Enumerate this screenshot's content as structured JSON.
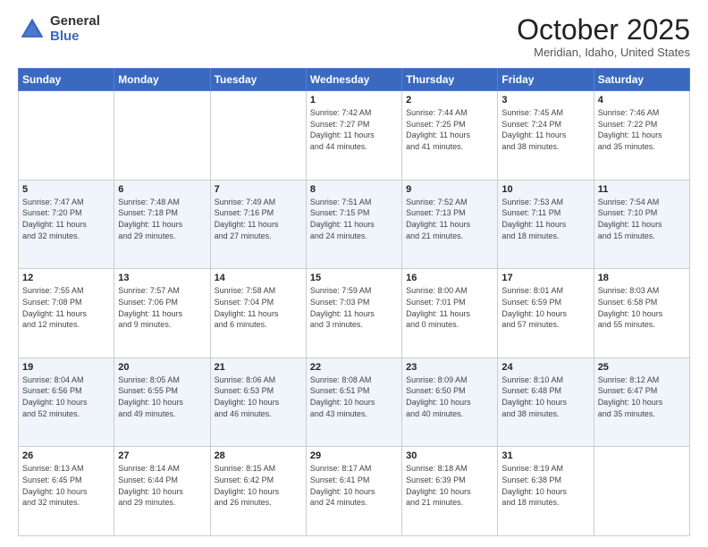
{
  "header": {
    "logo_general": "General",
    "logo_blue": "Blue",
    "title": "October 2025",
    "subtitle": "Meridian, Idaho, United States"
  },
  "weekdays": [
    "Sunday",
    "Monday",
    "Tuesday",
    "Wednesday",
    "Thursday",
    "Friday",
    "Saturday"
  ],
  "weeks": [
    [
      {
        "day": "",
        "info": ""
      },
      {
        "day": "",
        "info": ""
      },
      {
        "day": "",
        "info": ""
      },
      {
        "day": "1",
        "info": "Sunrise: 7:42 AM\nSunset: 7:27 PM\nDaylight: 11 hours\nand 44 minutes."
      },
      {
        "day": "2",
        "info": "Sunrise: 7:44 AM\nSunset: 7:25 PM\nDaylight: 11 hours\nand 41 minutes."
      },
      {
        "day": "3",
        "info": "Sunrise: 7:45 AM\nSunset: 7:24 PM\nDaylight: 11 hours\nand 38 minutes."
      },
      {
        "day": "4",
        "info": "Sunrise: 7:46 AM\nSunset: 7:22 PM\nDaylight: 11 hours\nand 35 minutes."
      }
    ],
    [
      {
        "day": "5",
        "info": "Sunrise: 7:47 AM\nSunset: 7:20 PM\nDaylight: 11 hours\nand 32 minutes."
      },
      {
        "day": "6",
        "info": "Sunrise: 7:48 AM\nSunset: 7:18 PM\nDaylight: 11 hours\nand 29 minutes."
      },
      {
        "day": "7",
        "info": "Sunrise: 7:49 AM\nSunset: 7:16 PM\nDaylight: 11 hours\nand 27 minutes."
      },
      {
        "day": "8",
        "info": "Sunrise: 7:51 AM\nSunset: 7:15 PM\nDaylight: 11 hours\nand 24 minutes."
      },
      {
        "day": "9",
        "info": "Sunrise: 7:52 AM\nSunset: 7:13 PM\nDaylight: 11 hours\nand 21 minutes."
      },
      {
        "day": "10",
        "info": "Sunrise: 7:53 AM\nSunset: 7:11 PM\nDaylight: 11 hours\nand 18 minutes."
      },
      {
        "day": "11",
        "info": "Sunrise: 7:54 AM\nSunset: 7:10 PM\nDaylight: 11 hours\nand 15 minutes."
      }
    ],
    [
      {
        "day": "12",
        "info": "Sunrise: 7:55 AM\nSunset: 7:08 PM\nDaylight: 11 hours\nand 12 minutes."
      },
      {
        "day": "13",
        "info": "Sunrise: 7:57 AM\nSunset: 7:06 PM\nDaylight: 11 hours\nand 9 minutes."
      },
      {
        "day": "14",
        "info": "Sunrise: 7:58 AM\nSunset: 7:04 PM\nDaylight: 11 hours\nand 6 minutes."
      },
      {
        "day": "15",
        "info": "Sunrise: 7:59 AM\nSunset: 7:03 PM\nDaylight: 11 hours\nand 3 minutes."
      },
      {
        "day": "16",
        "info": "Sunrise: 8:00 AM\nSunset: 7:01 PM\nDaylight: 11 hours\nand 0 minutes."
      },
      {
        "day": "17",
        "info": "Sunrise: 8:01 AM\nSunset: 6:59 PM\nDaylight: 10 hours\nand 57 minutes."
      },
      {
        "day": "18",
        "info": "Sunrise: 8:03 AM\nSunset: 6:58 PM\nDaylight: 10 hours\nand 55 minutes."
      }
    ],
    [
      {
        "day": "19",
        "info": "Sunrise: 8:04 AM\nSunset: 6:56 PM\nDaylight: 10 hours\nand 52 minutes."
      },
      {
        "day": "20",
        "info": "Sunrise: 8:05 AM\nSunset: 6:55 PM\nDaylight: 10 hours\nand 49 minutes."
      },
      {
        "day": "21",
        "info": "Sunrise: 8:06 AM\nSunset: 6:53 PM\nDaylight: 10 hours\nand 46 minutes."
      },
      {
        "day": "22",
        "info": "Sunrise: 8:08 AM\nSunset: 6:51 PM\nDaylight: 10 hours\nand 43 minutes."
      },
      {
        "day": "23",
        "info": "Sunrise: 8:09 AM\nSunset: 6:50 PM\nDaylight: 10 hours\nand 40 minutes."
      },
      {
        "day": "24",
        "info": "Sunrise: 8:10 AM\nSunset: 6:48 PM\nDaylight: 10 hours\nand 38 minutes."
      },
      {
        "day": "25",
        "info": "Sunrise: 8:12 AM\nSunset: 6:47 PM\nDaylight: 10 hours\nand 35 minutes."
      }
    ],
    [
      {
        "day": "26",
        "info": "Sunrise: 8:13 AM\nSunset: 6:45 PM\nDaylight: 10 hours\nand 32 minutes."
      },
      {
        "day": "27",
        "info": "Sunrise: 8:14 AM\nSunset: 6:44 PM\nDaylight: 10 hours\nand 29 minutes."
      },
      {
        "day": "28",
        "info": "Sunrise: 8:15 AM\nSunset: 6:42 PM\nDaylight: 10 hours\nand 26 minutes."
      },
      {
        "day": "29",
        "info": "Sunrise: 8:17 AM\nSunset: 6:41 PM\nDaylight: 10 hours\nand 24 minutes."
      },
      {
        "day": "30",
        "info": "Sunrise: 8:18 AM\nSunset: 6:39 PM\nDaylight: 10 hours\nand 21 minutes."
      },
      {
        "day": "31",
        "info": "Sunrise: 8:19 AM\nSunset: 6:38 PM\nDaylight: 10 hours\nand 18 minutes."
      },
      {
        "day": "",
        "info": ""
      }
    ]
  ]
}
